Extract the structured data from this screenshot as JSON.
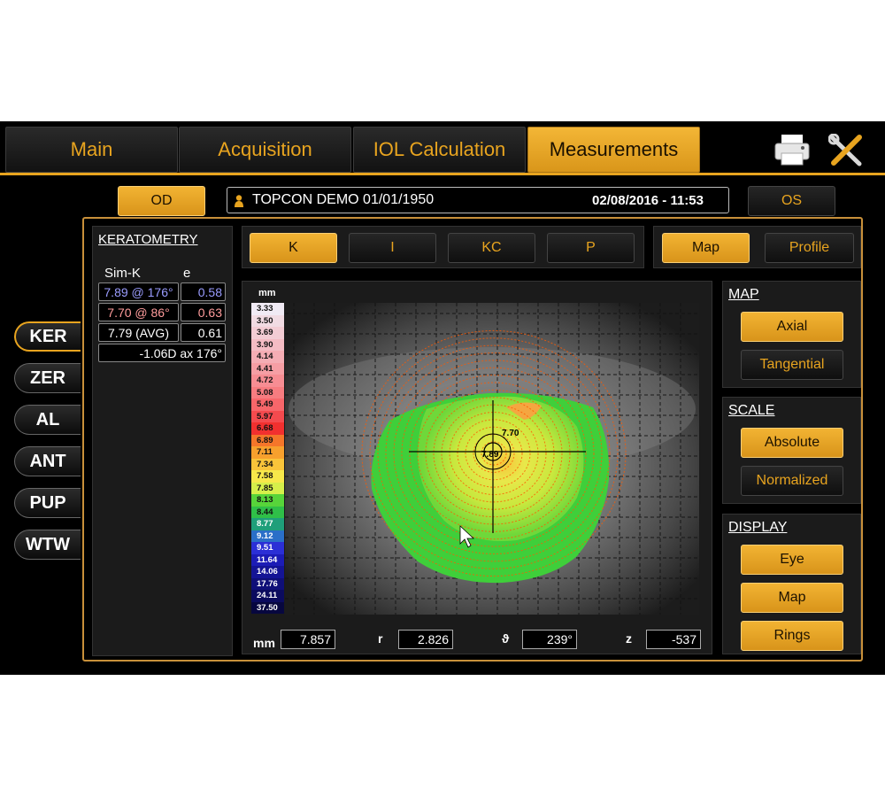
{
  "tabs": [
    {
      "label": "Main",
      "active": false
    },
    {
      "label": "Acquisition",
      "active": false
    },
    {
      "label": "IOL Calculation",
      "active": false
    },
    {
      "label": "Measurements",
      "active": true
    }
  ],
  "tools": {
    "print_icon": "printer-icon",
    "settings_icon": "tools-icon"
  },
  "eye_buttons": {
    "od": "OD",
    "os": "OS",
    "active": "OD"
  },
  "patient": {
    "name": "TOPCON DEMO 01/01/1950",
    "datetime": "02/08/2016 - 11:53"
  },
  "side_nav": [
    {
      "label": "KER",
      "active": true
    },
    {
      "label": "ZER",
      "active": false
    },
    {
      "label": "AL",
      "active": false
    },
    {
      "label": "ANT",
      "active": false
    },
    {
      "label": "PUP",
      "active": false
    },
    {
      "label": "WTW",
      "active": false
    }
  ],
  "keratometry": {
    "title": "KERATOMETRY",
    "col_simk": "Sim-K",
    "col_e": "e",
    "rows": [
      {
        "value": "7.89 @ 176°",
        "e": "0.58",
        "color": "#9a9cff"
      },
      {
        "value": "7.70 @ 86°",
        "e": "0.63",
        "color": "#ff9c9c"
      },
      {
        "value": "7.79 (AVG)",
        "e": "0.61",
        "color": "#ffffff"
      }
    ],
    "astig": "-1.06D ax 176°"
  },
  "mode_buttons": [
    {
      "label": "K",
      "active": true
    },
    {
      "label": "I",
      "active": false
    },
    {
      "label": "KC",
      "active": false
    },
    {
      "label": "P",
      "active": false
    }
  ],
  "view_buttons": [
    {
      "label": "Map",
      "active": true
    },
    {
      "label": "Profile",
      "active": false
    }
  ],
  "scale_legend": {
    "unit": "mm",
    "items": [
      {
        "value": "3.33",
        "color": "#f0eaf4"
      },
      {
        "value": "3.50",
        "color": "#f1dbe3"
      },
      {
        "value": "3.69",
        "color": "#f3ccd4"
      },
      {
        "value": "3.90",
        "color": "#f4bcc4"
      },
      {
        "value": "4.14",
        "color": "#f5adb4"
      },
      {
        "value": "4.41",
        "color": "#f69ea4"
      },
      {
        "value": "4.72",
        "color": "#f78d93"
      },
      {
        "value": "5.08",
        "color": "#f77c80"
      },
      {
        "value": "5.49",
        "color": "#f7666a"
      },
      {
        "value": "5.97",
        "color": "#f44a4e"
      },
      {
        "value": "6.68",
        "color": "#f2302f"
      },
      {
        "value": "6.89",
        "color": "#f5762a"
      },
      {
        "value": "7.11",
        "color": "#f7a02d"
      },
      {
        "value": "7.34",
        "color": "#f9c43a"
      },
      {
        "value": "7.58",
        "color": "#f7e84a"
      },
      {
        "value": "7.85",
        "color": "#d6ef4a"
      },
      {
        "value": "8.13",
        "color": "#57d43a"
      },
      {
        "value": "8.44",
        "color": "#2fbf48"
      },
      {
        "value": "8.77",
        "color": "#1f9f7a"
      },
      {
        "value": "9.12",
        "color": "#2a6fc8"
      },
      {
        "value": "9.51",
        "color": "#2b2fd6"
      },
      {
        "value": "11.64",
        "color": "#1c1cb6"
      },
      {
        "value": "14.06",
        "color": "#141495"
      },
      {
        "value": "17.76",
        "color": "#0f0f78"
      },
      {
        "value": "24.11",
        "color": "#0b0b5e"
      },
      {
        "value": "37.50",
        "color": "#07073f"
      }
    ]
  },
  "map_labels": {
    "k1": "7.70",
    "k2": "7.89"
  },
  "map_panel": {
    "title": "MAP",
    "options": [
      {
        "label": "Axial",
        "active": true
      },
      {
        "label": "Tangential",
        "active": false
      }
    ]
  },
  "scale_panel": {
    "title": "SCALE",
    "options": [
      {
        "label": "Absolute",
        "active": true
      },
      {
        "label": "Normalized",
        "active": false
      }
    ]
  },
  "display_panel": {
    "title": "DISPLAY",
    "options": [
      {
        "label": "Eye",
        "active": true
      },
      {
        "label": "Map",
        "active": true
      },
      {
        "label": "Rings",
        "active": true
      }
    ]
  },
  "readouts": [
    {
      "label": "mm",
      "value": "7.857"
    },
    {
      "label": "r",
      "value": "2.826"
    },
    {
      "label": "ϑ",
      "value": "239°"
    },
    {
      "label": "z",
      "value": "-537"
    }
  ],
  "colors": {
    "accent": "#e8a41f",
    "background": "#000000"
  }
}
